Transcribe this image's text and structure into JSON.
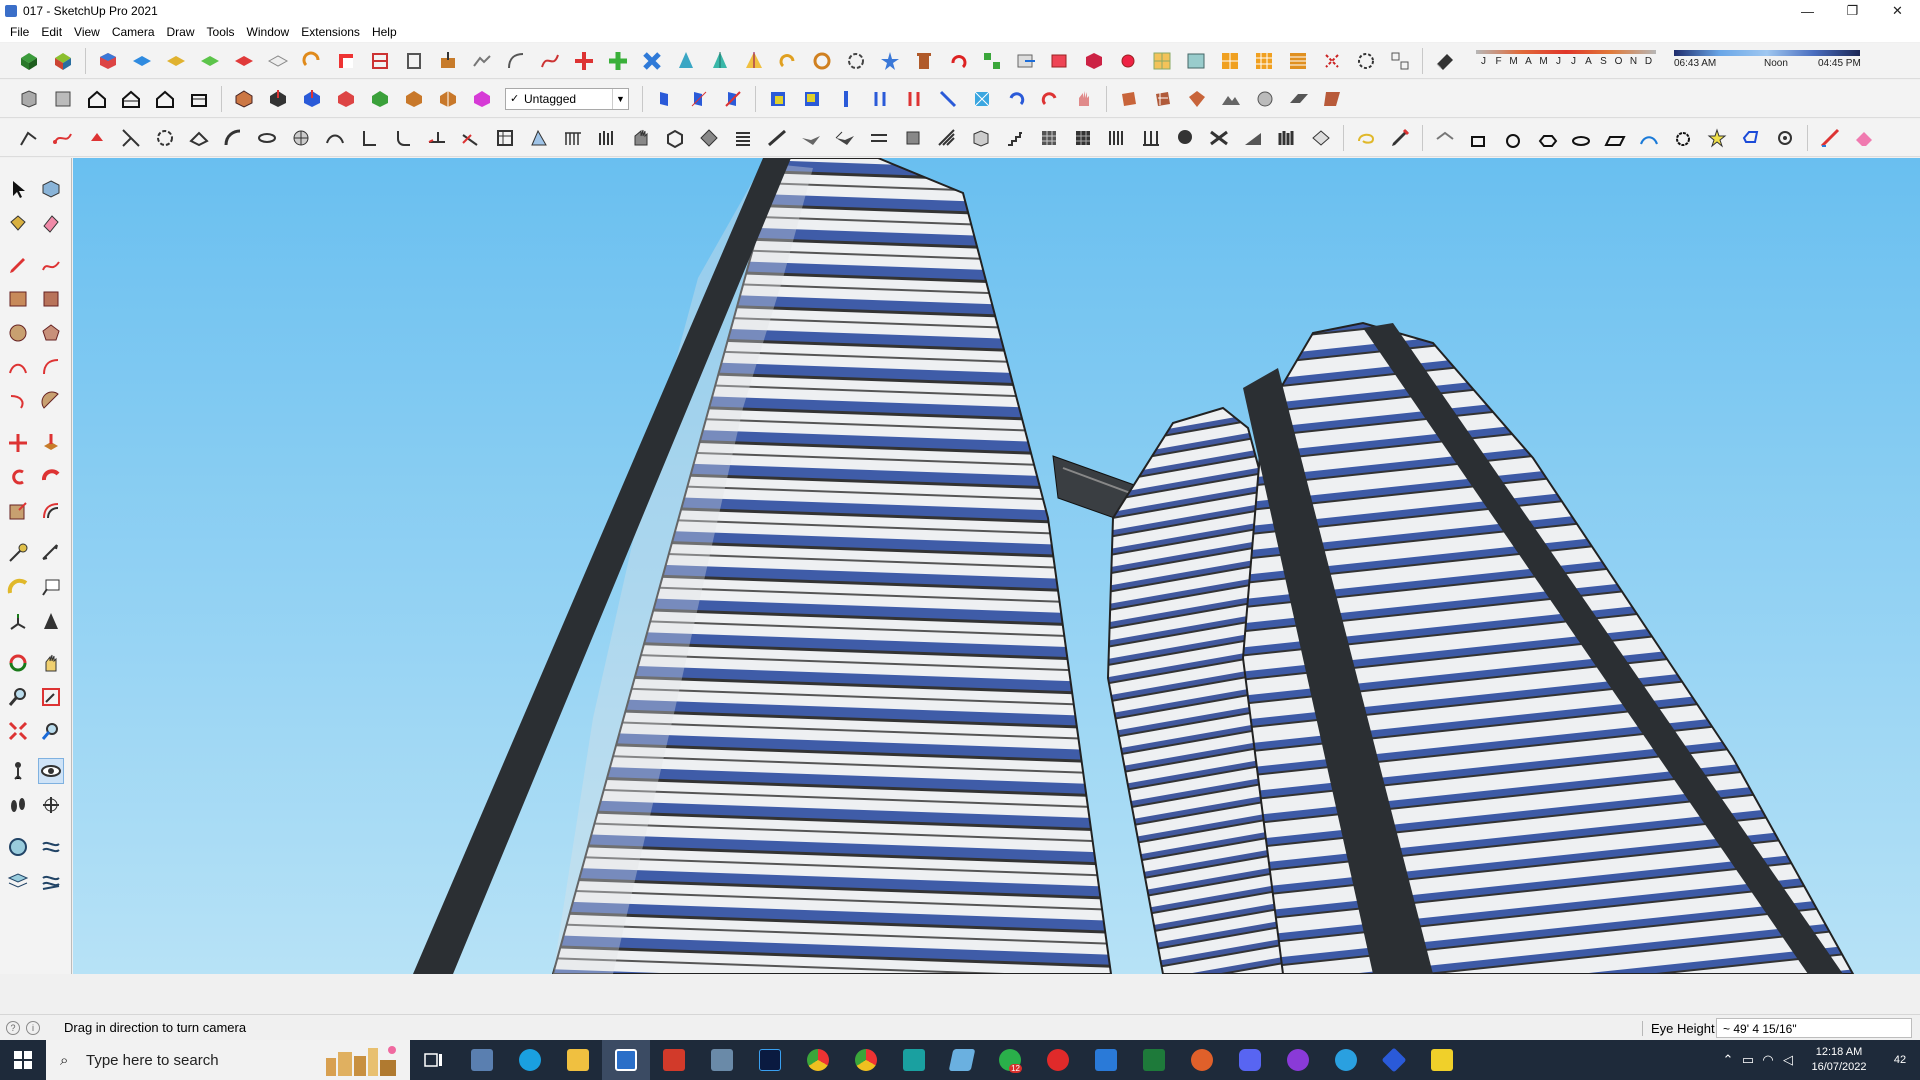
{
  "window": {
    "title": "017 - SketchUp Pro 2021",
    "controls": [
      "—",
      "❐",
      "✕"
    ]
  },
  "menubar": {
    "items": [
      "File",
      "Edit",
      "View",
      "Camera",
      "Draw",
      "Tools",
      "Window",
      "Extensions",
      "Help"
    ]
  },
  "toolbar": {
    "tag_dropdown_value": "Untagged",
    "tag_check": "✓"
  },
  "shadow": {
    "months": [
      "J",
      "F",
      "M",
      "A",
      "M",
      "J",
      "J",
      "A",
      "S",
      "O",
      "N",
      "D"
    ],
    "time_start": "06:43 AM",
    "time_mid": "Noon",
    "time_end": "04:45 PM"
  },
  "statusbar": {
    "message": "Drag in direction to turn camera",
    "eye_height_label": "Eye Height",
    "eye_height_value": "~ 49' 4 15/16\""
  },
  "taskbar": {
    "search_placeholder": "Type here to search",
    "whatsapp_badge": "12",
    "time": "12:18 AM",
    "date": "16/07/2022",
    "notification_count": "42"
  },
  "colors": {
    "sky_top": "#6fc3ee",
    "sky_bottom": "#a8daf4",
    "tower_light": "#e9ecee",
    "tower_blue": "#3d5caa",
    "frame_dark": "#2b2f33",
    "taskbar": "#1e2a3a"
  }
}
